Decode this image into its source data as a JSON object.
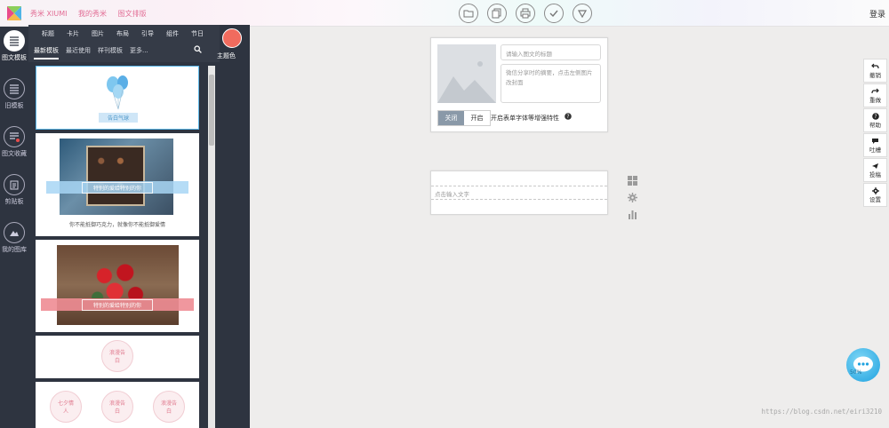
{
  "header": {
    "brand_links": [
      "秀米 XIUMI",
      "我的秀米",
      "图文排版"
    ],
    "login": "登录"
  },
  "left_nav": [
    {
      "label": "图文模板",
      "icon": "list-icon",
      "active": true
    },
    {
      "label": "旧模板",
      "icon": "list-icon"
    },
    {
      "label": "图文收藏",
      "icon": "bookmark-list-icon"
    },
    {
      "label": "剪贴板",
      "icon": "clipboard-icon"
    },
    {
      "label": "我的图库",
      "icon": "mountain-image-icon"
    }
  ],
  "panel": {
    "categories": [
      "标题",
      "卡片",
      "图片",
      "布局",
      "引导",
      "组件",
      "节日"
    ],
    "subtabs": [
      "最新模板",
      "最近使用",
      "样刊模板",
      "更多..."
    ],
    "theme_color_label": "主题色",
    "theme_color": "#f16b5e",
    "cards": [
      {
        "caption": "告白气球"
      },
      {
        "banner": "特别的爱给特别的你",
        "text": "你不能抵御巧克力，就像你不能抵御爱情"
      },
      {
        "banner": "特别的爱给特别的你"
      },
      {
        "badge": "浪漫告白"
      },
      {
        "badges": [
          "七夕情人",
          "浪漫告白",
          "浪漫告白"
        ]
      }
    ]
  },
  "editor": {
    "title_placeholder": "请输入图文的标题",
    "summary_placeholder": "微信分享时的摘要，点击左侧图片改封面",
    "toggle_off": "关闭",
    "toggle_on": "开启",
    "enhance_label": "开启表单字体等增强特性",
    "text_placeholder": "点击输入文字"
  },
  "right_toolbar": [
    {
      "label": "撤销",
      "icon": "undo-icon"
    },
    {
      "label": "重做",
      "icon": "redo-icon"
    },
    {
      "label": "帮助",
      "icon": "help-icon"
    },
    {
      "label": "吐槽",
      "icon": "comment-icon"
    },
    {
      "label": "投稿",
      "icon": "send-icon"
    },
    {
      "label": "设置",
      "icon": "gear-icon"
    }
  ],
  "chat_badge": "50%",
  "watermark": "https://blog.csdn.net/eiri3210"
}
